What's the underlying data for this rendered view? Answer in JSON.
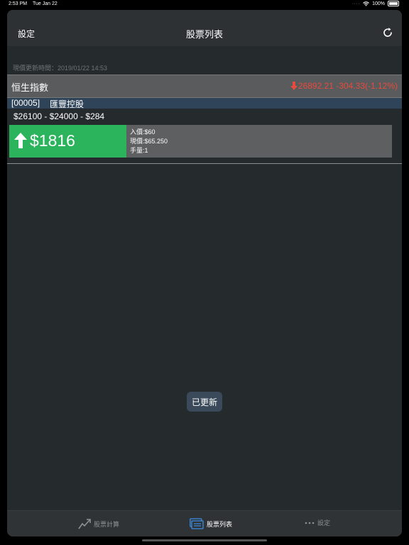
{
  "status_bar": {
    "time": "2:53 PM",
    "date": "Tue Jan 22",
    "battery": "100%"
  },
  "nav": {
    "left_label": "設定",
    "title": "股票列表",
    "refresh_icon": "refresh-icon"
  },
  "update_time": "現價更新時間：2019/01/22 14:53",
  "index": {
    "name": "恒生指數",
    "value": "26892.21 -304.33(-1.12%)",
    "direction": "down",
    "color": "#e84a3c"
  },
  "stock": {
    "code": "[00005]",
    "name": "匯豐控股",
    "price_line": "$26100 - $24000 - $284",
    "profit": "$1816",
    "profit_color": "#2bb45c",
    "details": {
      "buy_price": "入價:$60",
      "current_price": "現價:$65.250",
      "lots": "手量:1"
    }
  },
  "toast": "已更新",
  "tabs": [
    {
      "label": "股票計算",
      "icon": "chart-trend-icon",
      "active": false
    },
    {
      "label": "股票列表",
      "icon": "list-icon",
      "active": true
    },
    {
      "label": "設定",
      "icon": "more-dots-icon",
      "active": false
    }
  ],
  "colors": {
    "accent_blue": "#3a8ee6",
    "background": "#252a2c"
  }
}
